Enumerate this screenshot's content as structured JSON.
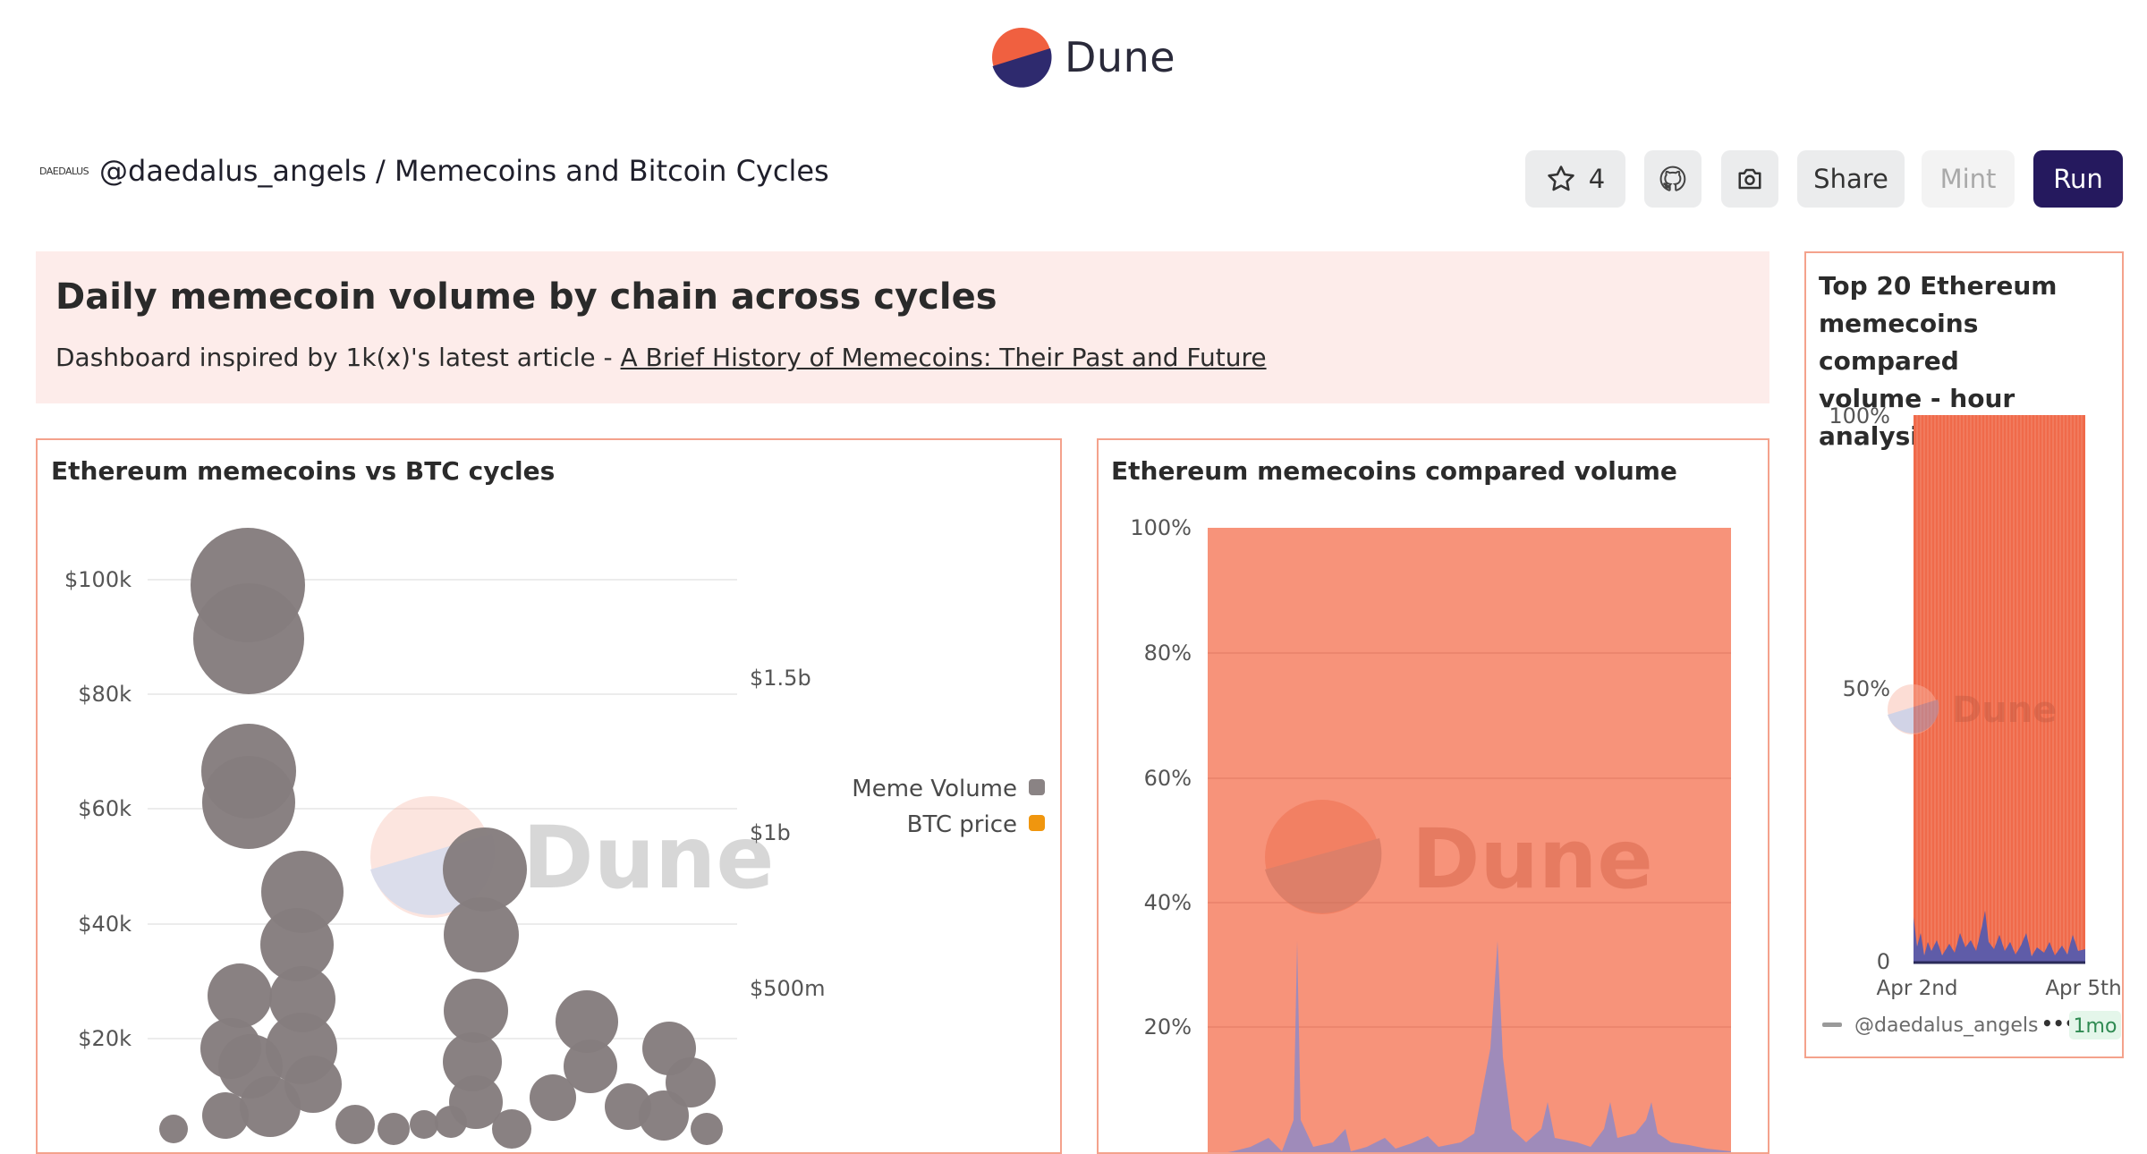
{
  "brand": {
    "name": "Dune"
  },
  "header": {
    "owner_mark": "DAEDALUS",
    "breadcrumb": "@daedalus_angels / Memecoins and Bitcoin Cycles",
    "star_count": "4",
    "share_label": "Share",
    "mint_label": "Mint",
    "run_label": "Run"
  },
  "text_panel": {
    "title": "Daily memecoin volume by chain across cycles",
    "desc_prefix": "Dashboard inspired by 1k(x)'s latest article - ",
    "link_text": "A Brief History of Memecoins: Their Past and Future"
  },
  "watermark": "Dune",
  "colors": {
    "accent": "#f06040",
    "run_bg": "#25195e",
    "meme_volume": "#8a8384",
    "btc_price": "#f0960e",
    "purple": "#6e6cc0"
  },
  "chart1": {
    "title": "Ethereum memecoins vs BTC cycles",
    "left_ticks": [
      "$100k",
      "$80k",
      "$60k",
      "$40k",
      "$20k"
    ],
    "right_ticks": [
      "$1.5b",
      "$1b",
      "$500m"
    ],
    "legend": [
      "Meme Volume",
      "BTC price"
    ]
  },
  "chart2": {
    "title": "Ethereum memecoins compared volume",
    "y_ticks": [
      "100%",
      "80%",
      "60%",
      "40%",
      "20%"
    ]
  },
  "chart3": {
    "title_lines": [
      "Top 20 Ethereum",
      "memecoins compared",
      "volume - hour analysis"
    ],
    "y_ticks": [
      "100%",
      "50%",
      "0"
    ],
    "x_ticks": [
      "Apr 2nd",
      "Apr 5th"
    ],
    "author": "@daedalus_angels",
    "more": "•••",
    "age": "1mo"
  },
  "chart_data": [
    {
      "type": "scatter",
      "title": "Ethereum memecoins vs BTC cycles",
      "ylabel_left": "BTC price",
      "ylabel_right": "Meme Volume",
      "ylim_left": [
        0,
        100000
      ],
      "series": [
        {
          "name": "Meme Volume",
          "axis": "right",
          "values": [
            1950000000,
            1770000000,
            1300000000,
            1280000000,
            880000000,
            590000000,
            710000000,
            200000000,
            240000000,
            1000000000,
            640000000
          ]
        },
        {
          "name": "BTC price",
          "axis": "left",
          "values": []
        }
      ],
      "legend_position": "right"
    },
    {
      "type": "area",
      "title": "Ethereum memecoins compared volume",
      "y_ticks": [
        "100%",
        "80%",
        "60%",
        "40%",
        "20%"
      ],
      "ylim": [
        0,
        100
      ],
      "grid": true
    },
    {
      "type": "bar",
      "title": "Top 20 Ethereum memecoins compared volume - hour analysis",
      "x_ticks": [
        "Apr 2nd",
        "Apr 5th"
      ],
      "ylim": [
        0,
        100
      ],
      "grid": false
    }
  ]
}
